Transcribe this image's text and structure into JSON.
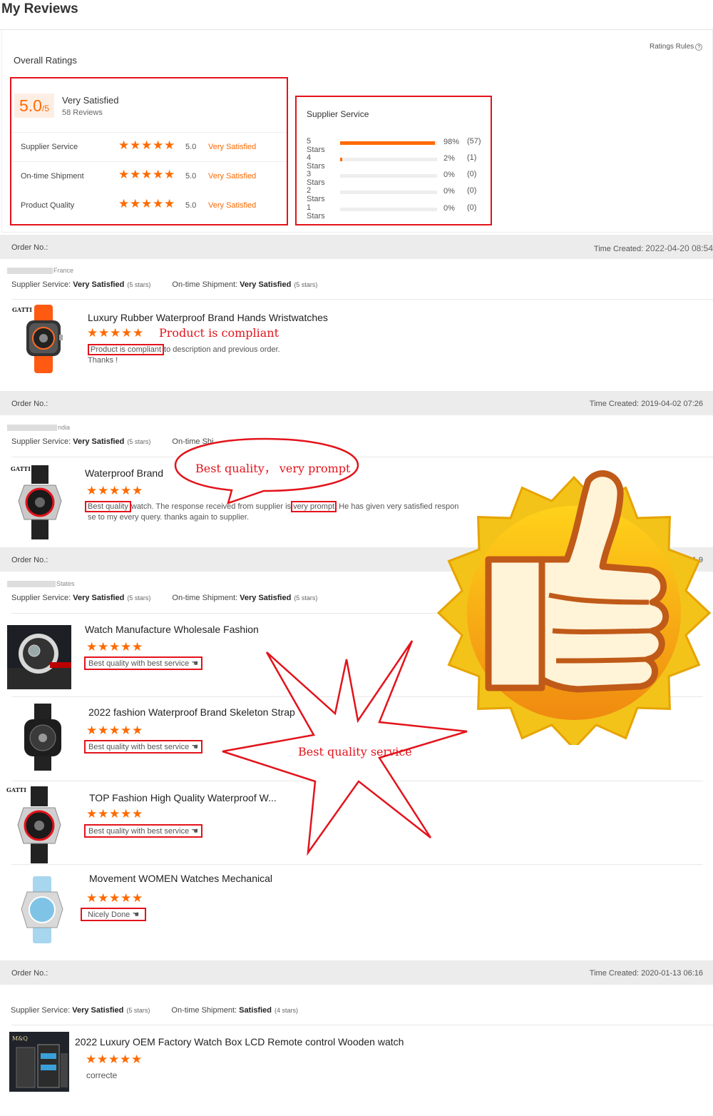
{
  "page": {
    "title": "My Reviews"
  },
  "overall": {
    "label": "Overall Ratings",
    "rules_link": "Ratings Rules",
    "score": "5.0",
    "score_out_of": "/5",
    "satisfaction": "Very Satisfied",
    "review_count": "58 Reviews",
    "rows": [
      {
        "label": "Supplier Service",
        "value": "5.0",
        "satisfaction": "Very Satisfied",
        "stars": 5
      },
      {
        "label": "On-time Shipment",
        "value": "5.0",
        "satisfaction": "Very Satisfied",
        "stars": 5
      },
      {
        "label": "Product Quality",
        "value": "5.0",
        "satisfaction": "Very Satisfied",
        "stars": 5
      }
    ]
  },
  "supplier_service": {
    "title": "Supplier Service",
    "distribution": [
      {
        "label": "5 Stars",
        "percent": "98%",
        "count": "(57)",
        "fraction": 0.98
      },
      {
        "label": "4 Stars",
        "percent": "2%",
        "count": "(1)",
        "fraction": 0.02
      },
      {
        "label": "3 Stars",
        "percent": "0%",
        "count": "(0)",
        "fraction": 0
      },
      {
        "label": "2 Stars",
        "percent": "0%",
        "count": "(0)",
        "fraction": 0
      },
      {
        "label": "1 Stars",
        "percent": "0%",
        "count": "(0)",
        "fraction": 0
      }
    ]
  },
  "labels": {
    "order_no": "Order No.:",
    "time_created": "Time Created:",
    "supplier_service": "Supplier Service:",
    "on_time_shipment": "On-time Shipment:",
    "very_satisfied": "Very Satisfied",
    "satisfied": "Satisfied",
    "five_stars": "(5 stars)",
    "four_stars": "(4 stars)"
  },
  "orders": [
    {
      "time": "2022-04-20 08:54",
      "location": "France",
      "products": [
        {
          "title": "Luxury Rubber Waterproof Brand Hands Wristwatches",
          "highlight": "Product is compliant",
          "comment_rest": "to description and previous order.",
          "comment_line2": "Thanks !",
          "annotation": "Product is compliant",
          "brand": "GATTI"
        }
      ]
    },
    {
      "time": "2019-04-02 07:26",
      "location": "ndia",
      "partial_shipment": "On-time Shi",
      "partial_stars": "(5 stars)",
      "products": [
        {
          "title": "Waterproof Brand",
          "hl1": "Best quality",
          "mid": "watch. The response received from supplier is",
          "hl2": "very prompt",
          "rest": "He has given very satisfied respon",
          "line2": "se to my every query. thanks again to supplier.",
          "brand": "GATTI"
        }
      ],
      "annotation": "Best quality， very prompt"
    },
    {
      "time_partial": "11  9",
      "location": "States",
      "products": [
        {
          "title": "Watch Manufacture Wholesale Fashion",
          "comment": "Best quality with best service"
        },
        {
          "title": "2022 fashion Waterproof Brand Skeleton Strap",
          "comment": "Best quality with best service"
        },
        {
          "title": "TOP Fashion High Quality Waterproof W...",
          "comment": "Best quality with best service",
          "brand": "GATTI"
        },
        {
          "title": "Movement WOMEN Watches Mechanical",
          "comment": "Nicely Done"
        }
      ],
      "annotation": "Best quality service"
    },
    {
      "time": "2020-01-13 06:16",
      "products": [
        {
          "title": "2022 Luxury OEM Factory Watch Box LCD Remote control Wooden watch",
          "comment": "correcte",
          "brand": "M&Q"
        }
      ]
    }
  ],
  "colors": {
    "accent": "#ff6a00",
    "annotation_red": "#e3131b",
    "order_bar": "#ececec"
  },
  "icons": {
    "star": "star-icon",
    "hand": "pointing-hand-icon",
    "thumbs_up": "thumbs-up-badge"
  }
}
